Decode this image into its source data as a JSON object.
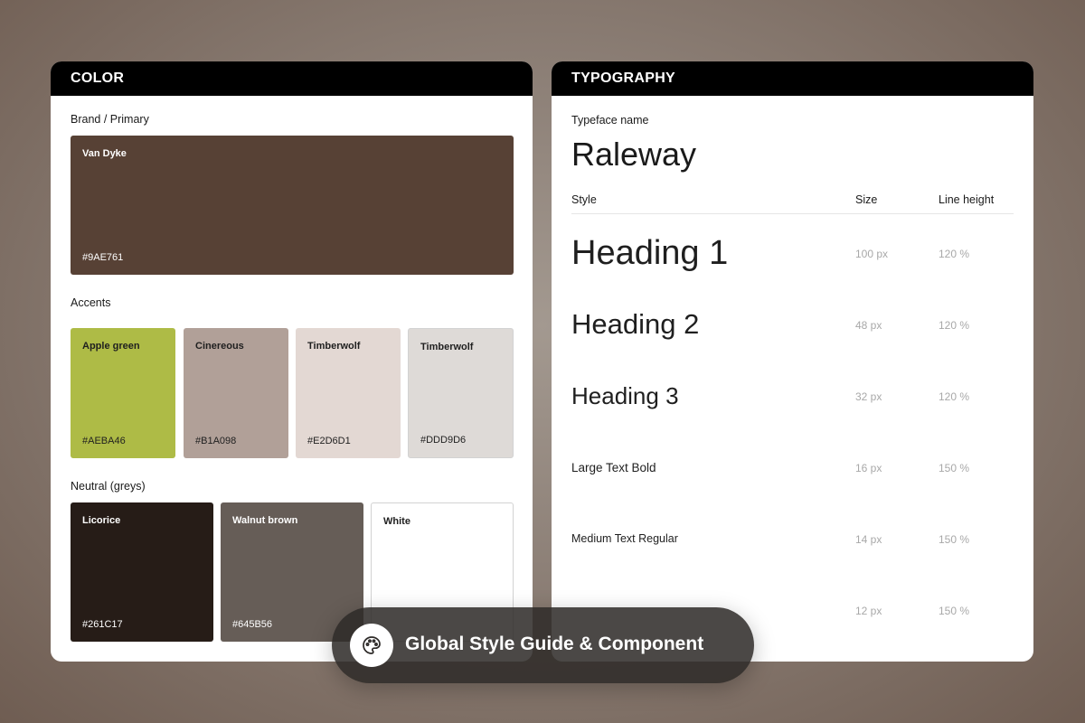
{
  "color_card": {
    "title": "COLOR",
    "brand_label": "Brand / Primary",
    "brand": {
      "name": "Van Dyke",
      "hex": "#9AE761",
      "swatch": "#574135"
    },
    "accents_label": "Accents",
    "accents": [
      {
        "name": "Apple green",
        "hex": "#AEBA46",
        "swatch": "#aebb46"
      },
      {
        "name": "Cinereous",
        "hex": "#B1A098",
        "swatch": "#b1a098"
      },
      {
        "name": "Timberwolf",
        "hex": "#E2D6D1",
        "swatch": "#e3d8d3"
      },
      {
        "name": "Timberwolf",
        "hex": "#DDD9D6",
        "swatch": "#dedad7"
      }
    ],
    "neutral_label": "Neutral (greys)",
    "neutrals": [
      {
        "name": "Licorice",
        "hex": "#261C17",
        "swatch": "#261c17"
      },
      {
        "name": "Walnut brown",
        "hex": "#645B56",
        "swatch": "#665d57"
      },
      {
        "name": "White",
        "hex": "",
        "swatch": "#ffffff"
      }
    ]
  },
  "type_card": {
    "title": "TYPOGRAPHY",
    "typeface_label": "Typeface name",
    "typeface": "Raleway",
    "columns": {
      "style": "Style",
      "size": "Size",
      "line_height": "Line height"
    },
    "rows": [
      {
        "style": "Heading 1",
        "size": "100 px",
        "line_height": "120 %"
      },
      {
        "style": "Heading 2",
        "size": "48 px",
        "line_height": "120 %"
      },
      {
        "style": "Heading 3",
        "size": "32 px",
        "line_height": "120 %"
      },
      {
        "style": "Large Text Bold",
        "size": "16 px",
        "line_height": "150 %"
      },
      {
        "style": "Medium Text Regular",
        "size": "14 px",
        "line_height": "150 %"
      },
      {
        "style": "",
        "size": "12 px",
        "line_height": "150 %"
      }
    ]
  },
  "banner": {
    "text": "Global Style Guide & Component",
    "icon": "palette-icon"
  }
}
